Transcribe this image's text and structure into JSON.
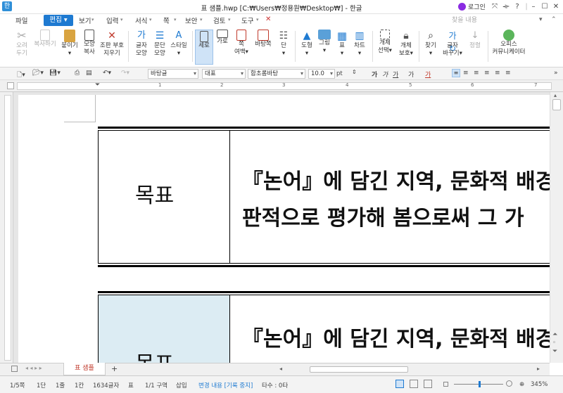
{
  "window": {
    "app_icon": "한",
    "title": "표 샘플.hwp [C:₩Users₩정용원₩Desktop₩] - 한글",
    "login": "로그인",
    "controls": [
      "⤧",
      "⟛",
      "?",
      "|",
      "–",
      "☐",
      "✕"
    ]
  },
  "menu": {
    "file": "파일",
    "edit": "편집",
    "items": [
      "보기",
      "입력",
      "서식",
      "쪽",
      "보안",
      "검토",
      "도구"
    ],
    "search_placeholder": "찾을 내용"
  },
  "ribbon": {
    "buttons": [
      {
        "label": "오려\n두기",
        "icon": "scissors-icon",
        "disabled": true
      },
      {
        "label": "복사하기",
        "icon": "copy-icon",
        "disabled": true
      },
      {
        "label": "붙이기\n▾",
        "icon": "paste-icon",
        "disabled": false
      },
      {
        "label": "모양\n복사",
        "icon": "format-painter-icon",
        "disabled": false
      },
      {
        "label": "조판 부호\n지우기",
        "icon": "clear-marks-icon",
        "disabled": false
      },
      {
        "label": "글자\n모양",
        "icon": "char-shape-icon",
        "disabled": false
      },
      {
        "label": "문단\n모양",
        "icon": "para-shape-icon",
        "disabled": false
      },
      {
        "label": "스타일\n▾",
        "icon": "style-icon",
        "disabled": false
      },
      {
        "label": "세로",
        "icon": "portrait-icon",
        "disabled": false,
        "selected": true
      },
      {
        "label": "가로",
        "icon": "landscape-icon",
        "disabled": false
      },
      {
        "label": "쪽\n여백▾",
        "icon": "margins-icon",
        "disabled": false
      },
      {
        "label": "바탕쪽",
        "icon": "master-page-icon",
        "disabled": false
      },
      {
        "label": "단\n▾",
        "icon": "columns-icon",
        "disabled": false
      },
      {
        "label": "도형\n▾",
        "icon": "shape-icon",
        "disabled": false
      },
      {
        "label": "그림\n▾",
        "icon": "picture-icon",
        "disabled": false
      },
      {
        "label": "표\n▾",
        "icon": "table-icon",
        "disabled": false
      },
      {
        "label": "차트\n▾",
        "icon": "chart-icon",
        "disabled": false
      },
      {
        "label": "개체\n선택▾",
        "icon": "object-select-icon",
        "disabled": false
      },
      {
        "label": "개체\n보호▾",
        "icon": "object-protect-icon",
        "disabled": false
      },
      {
        "label": "찾기\n▾",
        "icon": "find-icon",
        "disabled": false
      },
      {
        "label": "글자\n바꾸기▾",
        "icon": "replace-icon",
        "disabled": false
      },
      {
        "label": "정렬",
        "icon": "sort-icon",
        "disabled": true
      },
      {
        "label": "오피스\n커뮤니케이터",
        "icon": "office-communicator-icon",
        "disabled": false
      }
    ]
  },
  "format_bar": {
    "style_combo": "바탕글",
    "para_combo": "대표",
    "font_combo": "함초롬바탕",
    "size_value": "10.0",
    "size_unit": "pt",
    "format_buttons": [
      "가",
      "가",
      "가",
      "가",
      "가"
    ]
  },
  "ruler": {
    "numbers": [
      "1",
      "2",
      "3",
      "4",
      "5",
      "6",
      "7"
    ]
  },
  "document": {
    "table1": {
      "header": "목표",
      "line1": "『논어』에 담긴 지역, 문화적 배경",
      "line2": "판적으로 평가해 봄으로써 그 가"
    },
    "table2": {
      "header": "목표",
      "line1": "『논어』에 담긴 지역, 문화적 배경"
    }
  },
  "tabs": {
    "doc_tab": "표 샘플",
    "add": "+"
  },
  "status": {
    "page": "1/5쪽",
    "column": "1단",
    "line": "1줄",
    "char": "1칸",
    "count": "1634글자",
    "table": "표",
    "section": "1/1 구역",
    "mode": "삽입",
    "track": "변경 내용 [기록 중지]",
    "typing": "타수 : 0타",
    "zoom": "345%"
  },
  "colors": {
    "accent": "#1e7ad1",
    "cell_highlight": "#dcecf3",
    "tab_text": "#c0392b"
  }
}
